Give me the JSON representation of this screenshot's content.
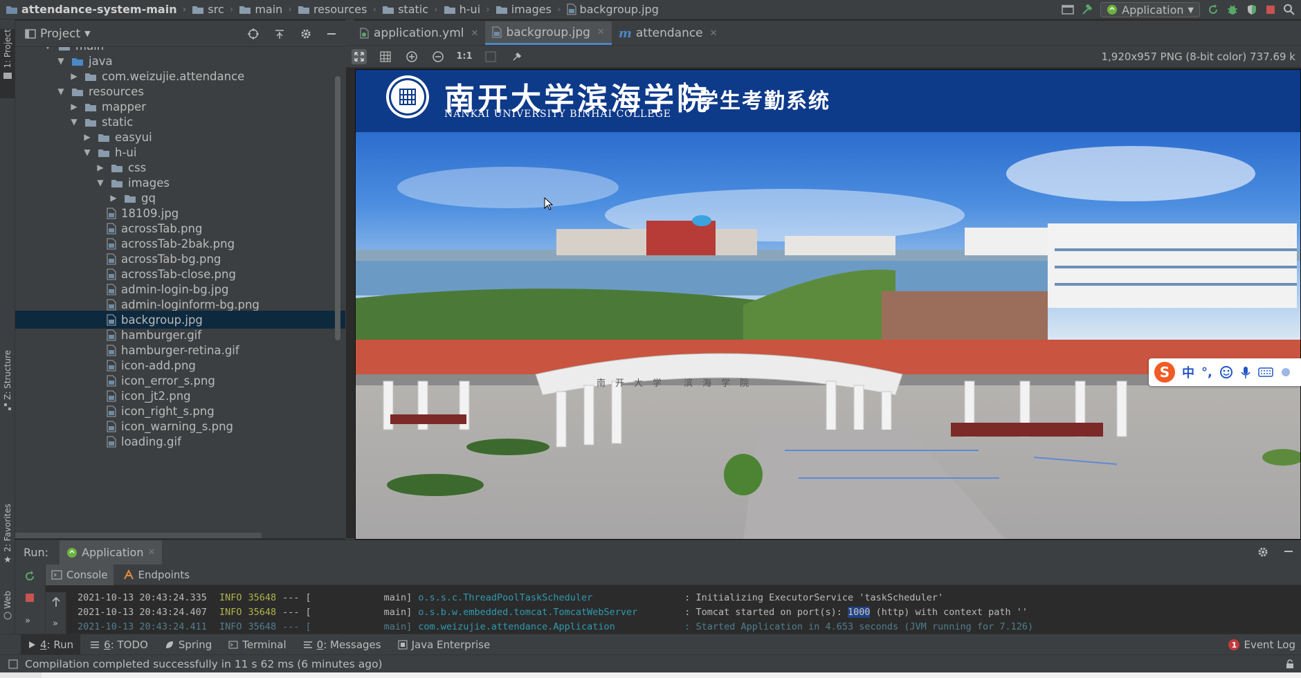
{
  "breadcrumbs": [
    "attendance-system-main",
    "src",
    "main",
    "resources",
    "static",
    "h-ui",
    "images",
    "backgroup.jpg"
  ],
  "run_config": {
    "label": "Application"
  },
  "left_strip": {
    "project": "1: Project",
    "structure": "Z: Structure",
    "favorites": "2: Favorites",
    "web": "Web"
  },
  "project_panel": {
    "title": "Project",
    "tree": [
      {
        "label": "main",
        "kind": "folder",
        "level": 0,
        "expanded": true
      },
      {
        "label": "java",
        "kind": "folder-src",
        "level": 1,
        "expanded": true
      },
      {
        "label": "com.weizujie.attendance",
        "kind": "package",
        "level": 2,
        "expanded": false
      },
      {
        "label": "resources",
        "kind": "folder-res",
        "level": 1,
        "expanded": true
      },
      {
        "label": "mapper",
        "kind": "folder",
        "level": 2,
        "expanded": false
      },
      {
        "label": "static",
        "kind": "folder",
        "level": 2,
        "expanded": true
      },
      {
        "label": "easyui",
        "kind": "folder",
        "level": 3,
        "expanded": false
      },
      {
        "label": "h-ui",
        "kind": "folder",
        "level": 3,
        "expanded": true
      },
      {
        "label": "css",
        "kind": "folder",
        "level": 4,
        "expanded": false
      },
      {
        "label": "images",
        "kind": "folder",
        "level": 4,
        "expanded": true
      },
      {
        "label": "gq",
        "kind": "folder",
        "level": 5,
        "expanded": false
      },
      {
        "label": "18109.jpg",
        "kind": "file",
        "level": 6
      },
      {
        "label": "acrossTab.png",
        "kind": "file",
        "level": 6
      },
      {
        "label": "acrossTab-2bak.png",
        "kind": "file",
        "level": 6
      },
      {
        "label": "acrossTab-bg.png",
        "kind": "file",
        "level": 6
      },
      {
        "label": "acrossTab-close.png",
        "kind": "file",
        "level": 6
      },
      {
        "label": "admin-login-bg.jpg",
        "kind": "file",
        "level": 6
      },
      {
        "label": "admin-loginform-bg.png",
        "kind": "file",
        "level": 6
      },
      {
        "label": "backgroup.jpg",
        "kind": "file",
        "level": 6,
        "selected": true
      },
      {
        "label": "hamburger.gif",
        "kind": "file",
        "level": 6
      },
      {
        "label": "hamburger-retina.gif",
        "kind": "file",
        "level": 6
      },
      {
        "label": "icon-add.png",
        "kind": "file",
        "level": 6
      },
      {
        "label": "icon_error_s.png",
        "kind": "file",
        "level": 6
      },
      {
        "label": "icon_jt2.png",
        "kind": "file",
        "level": 6
      },
      {
        "label": "icon_right_s.png",
        "kind": "file",
        "level": 6
      },
      {
        "label": "icon_warning_s.png",
        "kind": "file",
        "level": 6
      },
      {
        "label": "loading.gif",
        "kind": "file",
        "level": 6
      }
    ]
  },
  "editor": {
    "tabs": [
      {
        "label": "application.yml",
        "kind": "yml",
        "active": false
      },
      {
        "label": "backgroup.jpg",
        "kind": "image",
        "active": true
      },
      {
        "label": "attendance",
        "kind": "module",
        "active": false
      }
    ],
    "image_info": "1,920x957 PNG (8-bit color) 737.69 k",
    "zoom_1_1": "1:1"
  },
  "image_content": {
    "brand_cn": "南开大学滨海学院",
    "brand_en": "NANKAI UNIVERSITY BINHAI COLLEGE",
    "system_title": "学生考勤系统",
    "gate_inscription": "南开大学 滨海学院"
  },
  "ime_bar": {
    "label": "中",
    "punct": "°,"
  },
  "run_panel": {
    "label": "Run:",
    "config": "Application",
    "tabs": [
      "Console",
      "Endpoints"
    ],
    "lines": [
      {
        "ts": "2021-10-13 20:43:24.335",
        "level": "INFO",
        "pid": "35648",
        "sep": "---",
        "thread": "main]",
        "logger": "o.s.s.c.ThreadPoolTaskScheduler",
        "msg_pre": ": Initializing ExecutorService 'taskScheduler'",
        "hl": "",
        "msg_post": ""
      },
      {
        "ts": "2021-10-13 20:43:24.407",
        "level": "INFO",
        "pid": "35648",
        "sep": "---",
        "thread": "main]",
        "logger": "o.s.b.w.embedded.tomcat.TomcatWebServer",
        "msg_pre": ": Tomcat started on port(s): ",
        "hl": "1000",
        "msg_post": " (http) with context path ''"
      },
      {
        "ts": "2021-10-13 20:43:24.411",
        "level": "INFO",
        "pid": "35648",
        "sep": "---",
        "thread": "main]",
        "logger": "com.weizujie.attendance.Application",
        "msg_pre": ": Started Application in 4.653 seconds (JVM running for 7.126)",
        "hl": "",
        "msg_post": ""
      }
    ]
  },
  "bottom_tools": {
    "run": {
      "num": "4",
      "label": ": Run"
    },
    "todo": {
      "num": "6",
      "label": ": TODO"
    },
    "spring": "Spring",
    "terminal": "Terminal",
    "messages": {
      "num": "0",
      "label": ": Messages"
    },
    "java_enterprise": "Java Enterprise",
    "event_log": "Event Log",
    "event_count": "1"
  },
  "status": {
    "message": "Compilation completed successfully in 11 s 62 ms (6 minutes ago)"
  },
  "colors": {
    "bg": "#2b2b2b",
    "panel": "#3c3f41",
    "selection": "#0d293e",
    "accent": "#4a88c7",
    "header_blue": "#0e3a8a"
  }
}
